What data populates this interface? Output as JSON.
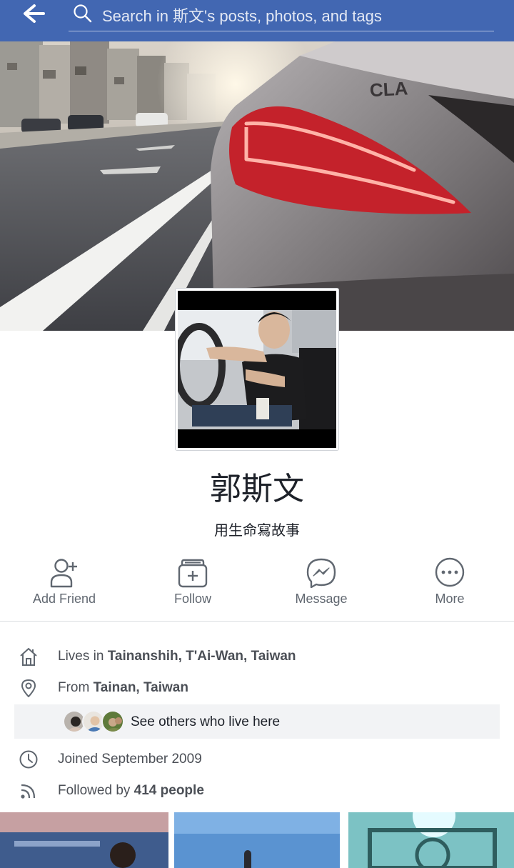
{
  "topbar": {
    "search_placeholder": "Search in 斯文's posts, photos, and tags"
  },
  "profile": {
    "name": "郭斯文",
    "bio": "用生命寫故事"
  },
  "actions": [
    {
      "label": "Add Friend",
      "icon": "add-friend-icon"
    },
    {
      "label": "Follow",
      "icon": "follow-icon"
    },
    {
      "label": "Message",
      "icon": "messenger-icon"
    },
    {
      "label": "More",
      "icon": "more-icon"
    }
  ],
  "info": {
    "lives": {
      "prefix": "Lives in ",
      "value": "Tainanshih, T'Ai-Wan, Taiwan"
    },
    "from": {
      "prefix": "From ",
      "value": "Tainan, Taiwan"
    },
    "others": "See others who live here",
    "joined": "Joined September 2009",
    "followed": {
      "prefix": "Followed by ",
      "value": "414 people"
    }
  },
  "colors": {
    "brand": "#4267b2",
    "secondary_text": "#606770",
    "panel": "#f2f3f5"
  }
}
